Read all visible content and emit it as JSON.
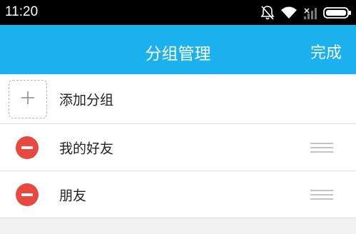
{
  "status_bar": {
    "time": "11:20",
    "icons": [
      "bell-off-icon",
      "wifi-icon",
      "signal-icon",
      "battery-icon"
    ]
  },
  "header": {
    "title": "分组管理",
    "done_label": "完成",
    "background_color": "#1ab1ee"
  },
  "add_group": {
    "label": "添加分组",
    "icon": "plus-icon"
  },
  "groups": [
    {
      "label": "我的好友"
    },
    {
      "label": "朋友"
    }
  ],
  "colors": {
    "remove": "#e8483e"
  }
}
